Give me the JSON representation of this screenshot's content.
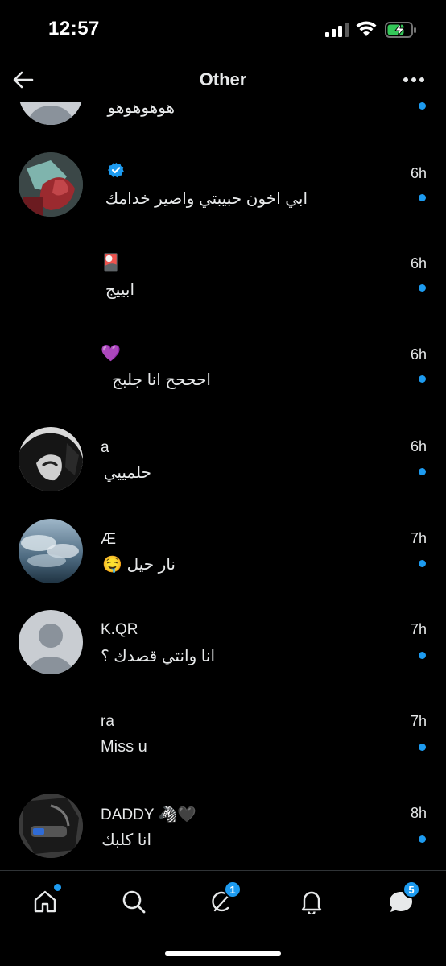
{
  "status_bar": {
    "time": "12:57"
  },
  "header": {
    "title": "Other",
    "back_icon": "arrow-left-icon",
    "more_icon": "more-horizontal-icon"
  },
  "conversations": [
    {
      "name": "",
      "message": "هوهوهوهو",
      "time": "",
      "unread": true
    },
    {
      "name": "",
      "verified": true,
      "message": "ابي اخون حبيبتي واصير خدامك",
      "time": "6h",
      "unread": true
    },
    {
      "name": "🎴",
      "message": "ابييج",
      "time": "6h",
      "unread": true
    },
    {
      "name": "💜",
      "message": "احححح انا جلبج",
      "time": "6h",
      "unread": true
    },
    {
      "name": "a",
      "message": "حلمييي",
      "time": "6h",
      "unread": true
    },
    {
      "name": "Æ",
      "message": "نار حيل 🤤",
      "time": "7h",
      "unread": true
    },
    {
      "name": "K.QR",
      "message": "انا وانتي قصدك ؟",
      "time": "7h",
      "unread": true
    },
    {
      "name": "ra",
      "message": "Miss u",
      "time": "7h",
      "unread": true
    },
    {
      "name": "DADDY 🦓🖤",
      "message": "انا كلبك",
      "time": "8h",
      "unread": true
    }
  ],
  "bottom_nav": {
    "items": [
      {
        "name": "home-icon",
        "dot": true
      },
      {
        "name": "search-icon"
      },
      {
        "name": "grok-icon",
        "badge": "1"
      },
      {
        "name": "bell-icon"
      },
      {
        "name": "messages-icon",
        "badge": "5"
      }
    ]
  },
  "colors": {
    "accent": "#1d9bf0",
    "background": "#000000",
    "text": "#e7e9ea"
  }
}
